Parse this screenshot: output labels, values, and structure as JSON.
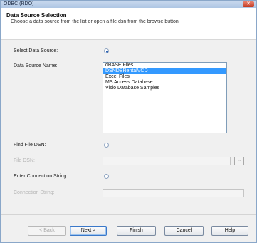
{
  "window": {
    "title": "ODBC (RDO)",
    "close_label": "✕"
  },
  "header": {
    "title": "Data Source Selection",
    "subtitle": "Choose a data source from the list or open a file dsn from the browse button"
  },
  "form": {
    "select_data_source_label": "Select Data Source:",
    "data_source_name_label": "Data Source Name:",
    "data_sources": [
      {
        "label": "dBASE Files",
        "selected": false
      },
      {
        "label": "DSNDBRentalVCD",
        "selected": true
      },
      {
        "label": "Excel Files",
        "selected": false
      },
      {
        "label": "MS Access Database",
        "selected": false
      },
      {
        "label": "Visio Database Samples",
        "selected": false
      }
    ],
    "find_file_dsn_label": "Find File DSN:",
    "file_dsn_label": "File DSN:",
    "file_dsn_value": "",
    "browse_label": "...",
    "enter_connection_string_label": "Enter Connection String:",
    "connection_string_label": "Connection String:",
    "connection_string_value": ""
  },
  "buttons": {
    "back": "< Back",
    "next": "Next >",
    "finish": "Finish",
    "cancel": "Cancel",
    "help": "Help"
  },
  "colors": {
    "selection": "#3399ff",
    "title_bar": "#aec6e4"
  }
}
